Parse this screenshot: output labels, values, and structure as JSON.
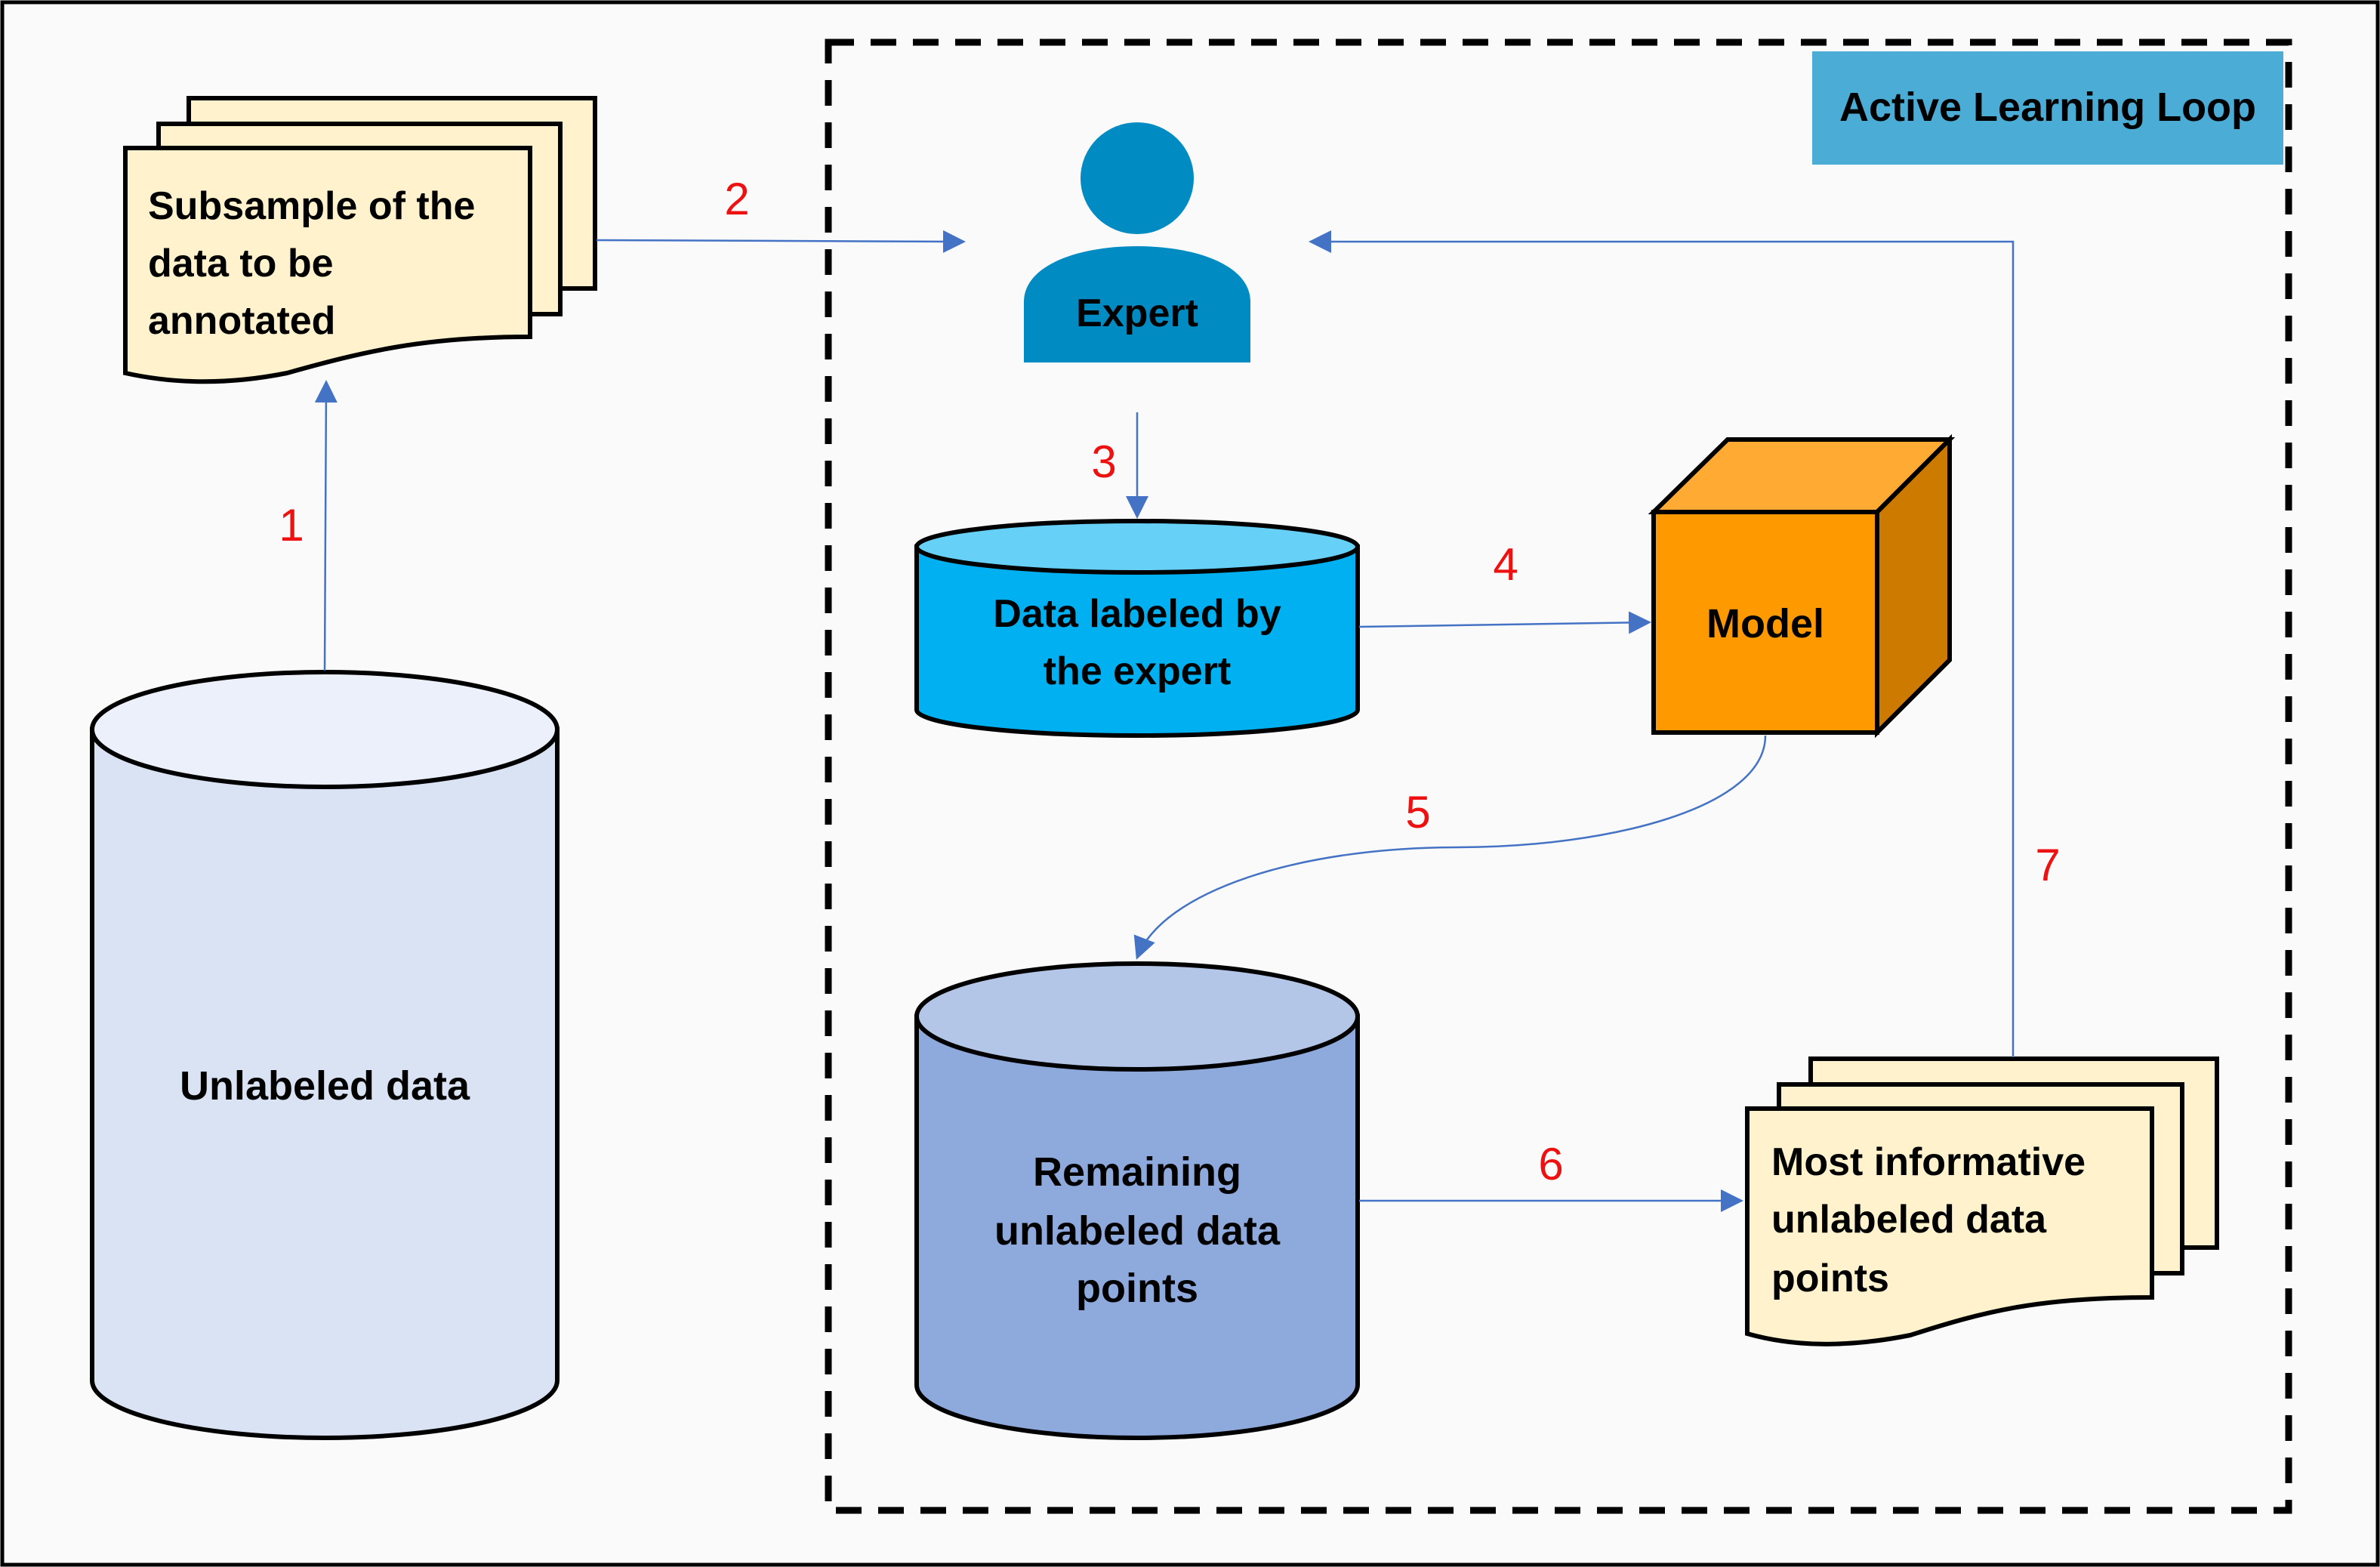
{
  "title_badge": {
    "label": "Active Learning Loop",
    "color": "#4bacd6"
  },
  "nodes": {
    "unlabeled_data": {
      "label_lines": [
        "Unlabeled data"
      ],
      "fill": "#dae3f3",
      "top_fill": "#ebf0fa"
    },
    "subsample": {
      "label_lines": [
        "Subsample of the",
        "data to be",
        "annotated"
      ],
      "fill": "#fff2cc"
    },
    "expert": {
      "label_lines": [
        "Expert"
      ],
      "fill": "#008bc3"
    },
    "labeled_data": {
      "label_lines": [
        "Data labeled by",
        "the expert"
      ],
      "fill": "#00b0f0",
      "top_fill": "#66d0f6"
    },
    "model": {
      "label_lines": [
        "Model"
      ],
      "front_fill": "#ff9900",
      "top_fill": "#ffaa33",
      "side_fill": "#cc7a00"
    },
    "remaining_data": {
      "label_lines": [
        "Remaining",
        "unlabeled data",
        "points"
      ],
      "fill": "#8ea9db",
      "top_fill": "#b4c6e7"
    },
    "most_informative": {
      "label_lines": [
        "Most informative",
        "unlabeled data",
        "points"
      ],
      "fill": "#fff2cc"
    }
  },
  "steps": [
    {
      "number": "1",
      "from": "Unlabeled data",
      "to": "Subsample of the data to be annotated"
    },
    {
      "number": "2",
      "from": "Subsample of the data to be annotated",
      "to": "Expert"
    },
    {
      "number": "3",
      "from": "Expert",
      "to": "Data labeled by the expert"
    },
    {
      "number": "4",
      "from": "Data labeled by the expert",
      "to": "Model"
    },
    {
      "number": "5",
      "from": "Model",
      "to": "Remaining unlabeled data points"
    },
    {
      "number": "6",
      "from": "Remaining unlabeled data points",
      "to": "Most informative unlabeled data points"
    },
    {
      "number": "7",
      "from": "Most informative unlabeled data points",
      "to": "Expert"
    }
  ],
  "colors": {
    "connector": "#4472c4",
    "step_number": "#ee1111",
    "loop_border": "#000000",
    "background": "#fafafa"
  }
}
